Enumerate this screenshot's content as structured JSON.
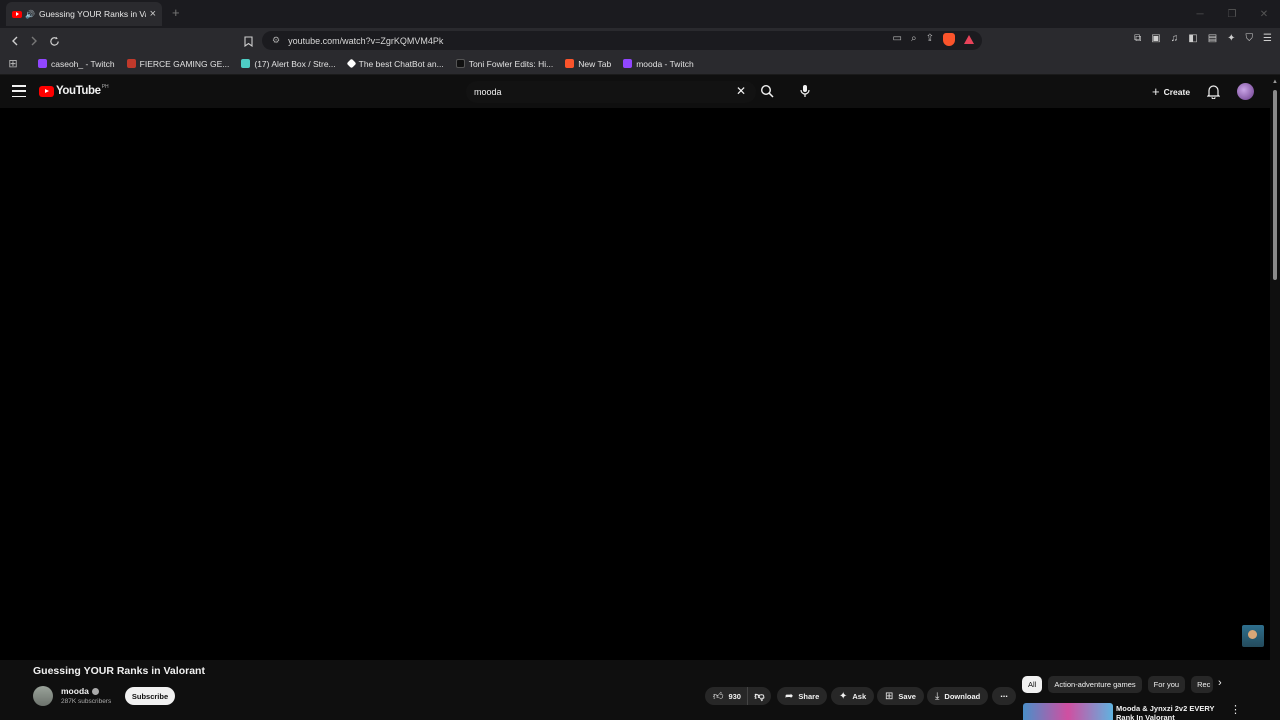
{
  "browser": {
    "tab_title": "Guessing YOUR Ranks in Valorant",
    "new_tab": "+",
    "url": "youtube.com/watch?v=ZgrKQMVM4Pk",
    "bookmarks": [
      {
        "label": "caseoh_ - Twitch",
        "color": "#9146ff"
      },
      {
        "label": "FIERCE GAMING GE...",
        "color": "#c0392b"
      },
      {
        "label": "(17) Alert Box / Stre...",
        "color": "#4ecdc4"
      },
      {
        "label": "The best ChatBot an...",
        "color": "#ffffff"
      },
      {
        "label": "Toni Fowler Edits: Hi...",
        "color": "#111111"
      },
      {
        "label": "New Tab",
        "color": "#fb542b"
      },
      {
        "label": "mooda - Twitch",
        "color": "#9146ff"
      }
    ]
  },
  "youtube": {
    "logo_text": "YouTube",
    "country_code": "PH",
    "search_value": "mooda",
    "create_label": "Create"
  },
  "video": {
    "title": "Guessing YOUR Ranks in Valorant",
    "channel_name": "mooda",
    "subscribers": "287K subscribers",
    "subscribe_label": "Subscribe",
    "likes": "930",
    "share_label": "Share",
    "ask_label": "Ask",
    "save_label": "Save",
    "download_label": "Download"
  },
  "sidebar": {
    "chips": [
      "All",
      "Action-adventure games",
      "For you",
      "Rec"
    ],
    "recommendation_title": "Mooda & Jynxzi 2v2 EVERY Rank In Valorant"
  }
}
